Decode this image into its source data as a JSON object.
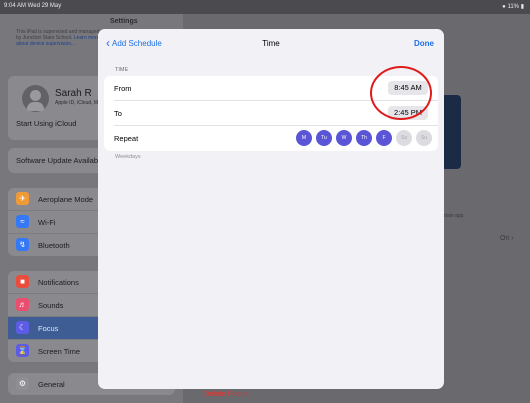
{
  "status_bar": {
    "time": "9:04 AM  Wed 29 May",
    "battery": "11%"
  },
  "sidebar": {
    "title": "Settings",
    "supervision_note": "This iPad is supervised and managed by Junction State School.",
    "supervision_link": "Learn more about device supervision...",
    "profile": {
      "name": "Sarah R",
      "subtitle": "Apple ID, iCloud, Media & Purchases"
    },
    "icloud_prompt": "Start Using iCloud",
    "software_update": "Software Update Available",
    "connectivity": [
      {
        "label": "Aeroplane Mode",
        "icon": "aeroplane-icon",
        "color": "#f09a37"
      },
      {
        "label": "Wi-Fi",
        "icon": "wifi-icon",
        "color": "#3478f6"
      },
      {
        "label": "Bluetooth",
        "icon": "bluetooth-icon",
        "color": "#3478f6"
      }
    ],
    "apps": [
      {
        "label": "Notifications",
        "icon": "notifications-icon",
        "color": "#eb4d3d"
      },
      {
        "label": "Sounds",
        "icon": "sounds-icon",
        "color": "#eb4d6e"
      },
      {
        "label": "Focus",
        "icon": "moon-icon",
        "color": "#5e5ce6",
        "selected": true
      },
      {
        "label": "Screen Time",
        "icon": "hourglass-icon",
        "color": "#5e5ce6"
      }
    ],
    "general": {
      "label": "General",
      "icon": "gear-icon",
      "color": "#8e8e93"
    }
  },
  "detail": {
    "allow_note": "...ertain app.",
    "on_value": "On",
    "delete_focus": "Delete Focus"
  },
  "sheet": {
    "back_label": "Add Schedule",
    "title": "Time",
    "done_label": "Done",
    "section_header": "TIME",
    "from": {
      "label": "From",
      "value": "8:45 AM"
    },
    "to": {
      "label": "To",
      "value": "2:45 PM"
    },
    "repeat": {
      "label": "Repeat",
      "days": [
        {
          "label": "M",
          "selected": true
        },
        {
          "label": "Tu",
          "selected": true
        },
        {
          "label": "W",
          "selected": true
        },
        {
          "label": "Th",
          "selected": true
        },
        {
          "label": "F",
          "selected": true
        },
        {
          "label": "Sa",
          "selected": false
        },
        {
          "label": "Su",
          "selected": false
        }
      ]
    },
    "footer_note": "Weekdays"
  },
  "annotation": {
    "color": "#e01b1b"
  }
}
